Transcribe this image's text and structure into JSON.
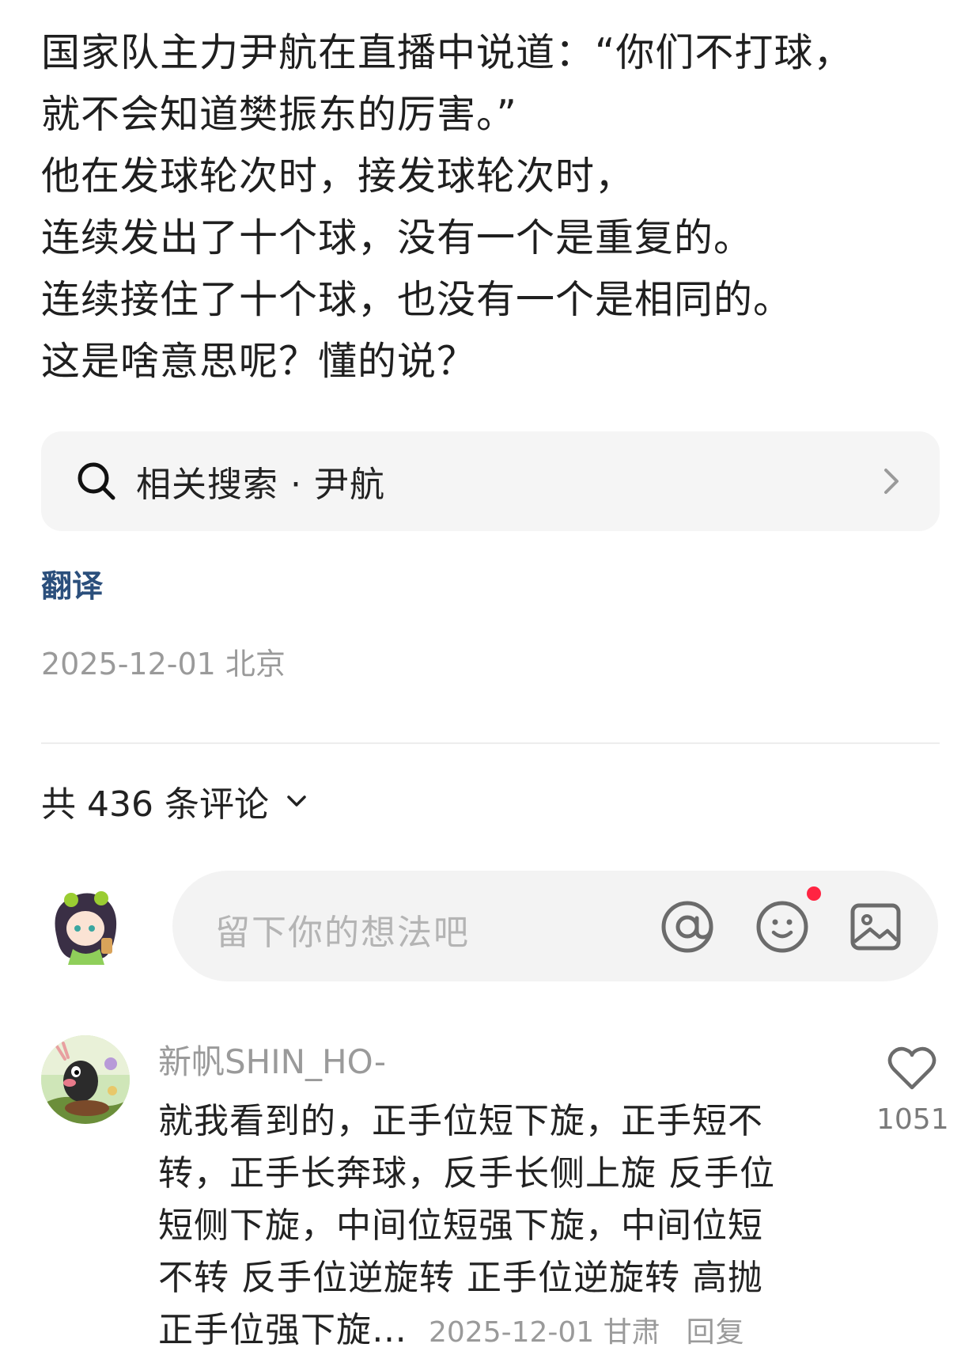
{
  "post": {
    "lines": [
      "国家队主力尹航在直播中说道：“你们不打球，",
      "就不会知道樊振东的厉害。”",
      "他在发球轮次时，接发球轮次时，",
      "连续发出了十个球，没有一个是重复的。",
      "连续接住了十个球，也没有一个是相同的。",
      "这是啥意思呢？懂的说？"
    ],
    "related_search_label": "相关搜索 · 尹航",
    "translate_label": "翻译",
    "meta": "2025-12-01 北京"
  },
  "comments_header": {
    "count_label": "共 436 条评论"
  },
  "comment_input": {
    "placeholder": "留下你的想法吧",
    "icons": [
      "at-icon",
      "emoji-icon",
      "image-icon"
    ],
    "emoji_badge_color": "#ff2442"
  },
  "comments": [
    {
      "username": "新帆SHIN_HO-",
      "text_lines": [
        "就我看到的，正手位短下旋，正手短不",
        "转，正手长奔球，反手长侧上旋 反手位",
        "短侧下旋，中间位短强下旋，中间位短",
        "不转 反手位逆旋转 正手位逆旋转 高抛",
        "正手位强下旋…"
      ],
      "meta": "2025-12-01 甘肃",
      "reply_label": "回复",
      "likes": "1051"
    }
  ],
  "colors": {
    "link": "#2b4f7c",
    "muted": "#9a9a9a",
    "search_bg": "#f5f5f5",
    "input_bg": "#f3f3f3"
  }
}
